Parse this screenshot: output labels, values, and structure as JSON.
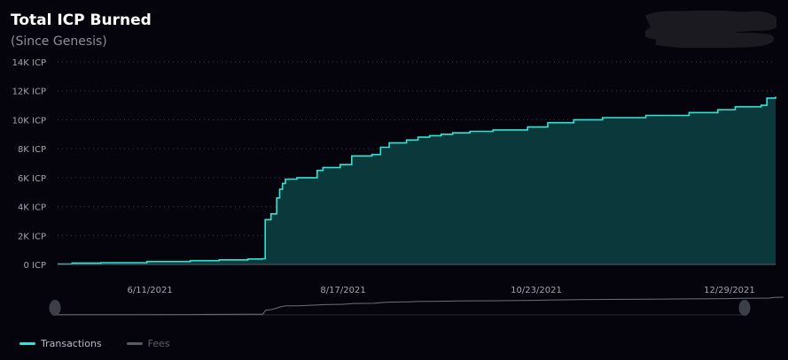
{
  "title": "Total ICP Burned",
  "subtitle": "(Since Genesis)",
  "colors": {
    "background": "#05040d",
    "transactions_line": "#2ee6d6",
    "transactions_fill": "#0b3b3e",
    "fees_line": "#5a5c63",
    "grid": "#3a3b46",
    "tick_text": "#a3a5ae",
    "navigator_line": "#6d6f77",
    "handle": "#3d3f48"
  },
  "legend": {
    "transactions": "Transactions",
    "fees": "Fees"
  },
  "chart_data": {
    "type": "area",
    "ylabel": "",
    "xlabel": "",
    "yticks": [
      "0 ICP",
      "2K ICP",
      "4K ICP",
      "6K ICP",
      "8K ICP",
      "10K ICP",
      "12K ICP",
      "14K ICP"
    ],
    "ylim": [
      0,
      14000
    ],
    "xticks": [
      "6/11/2021",
      "8/17/2021",
      "10/23/2021",
      "12/29/2021"
    ],
    "xlim": [
      "2021-05-10",
      "2022-01-14"
    ],
    "grid": "horizontal dotted",
    "legend_position": "bottom-left",
    "series": [
      {
        "name": "Transactions",
        "x": [
          "2021-05-10",
          "2021-05-15",
          "2021-05-25",
          "2021-06-10",
          "2021-06-25",
          "2021-07-05",
          "2021-07-15",
          "2021-07-20",
          "2021-07-21",
          "2021-07-23",
          "2021-07-25",
          "2021-07-26",
          "2021-07-27",
          "2021-07-28",
          "2021-08-01",
          "2021-08-08",
          "2021-08-10",
          "2021-08-16",
          "2021-08-20",
          "2021-08-27",
          "2021-08-30",
          "2021-09-02",
          "2021-09-08",
          "2021-09-12",
          "2021-09-16",
          "2021-09-20",
          "2021-09-24",
          "2021-09-30",
          "2021-10-08",
          "2021-10-20",
          "2021-10-27",
          "2021-11-05",
          "2021-11-15",
          "2021-11-30",
          "2021-12-15",
          "2021-12-25",
          "2021-12-31",
          "2022-01-09",
          "2022-01-11",
          "2022-01-14"
        ],
        "values": [
          30,
          100,
          120,
          200,
          260,
          320,
          380,
          400,
          3100,
          3500,
          4600,
          5200,
          5600,
          5900,
          6000,
          6500,
          6700,
          6900,
          7500,
          7600,
          8100,
          8400,
          8600,
          8800,
          8900,
          9000,
          9100,
          9200,
          9300,
          9500,
          9800,
          10000,
          10150,
          10300,
          10500,
          10700,
          10900,
          11000,
          11500,
          11600
        ]
      },
      {
        "name": "Fees",
        "x": [
          "2021-05-10",
          "2022-01-14"
        ],
        "values": [
          0,
          0
        ]
      }
    ]
  }
}
